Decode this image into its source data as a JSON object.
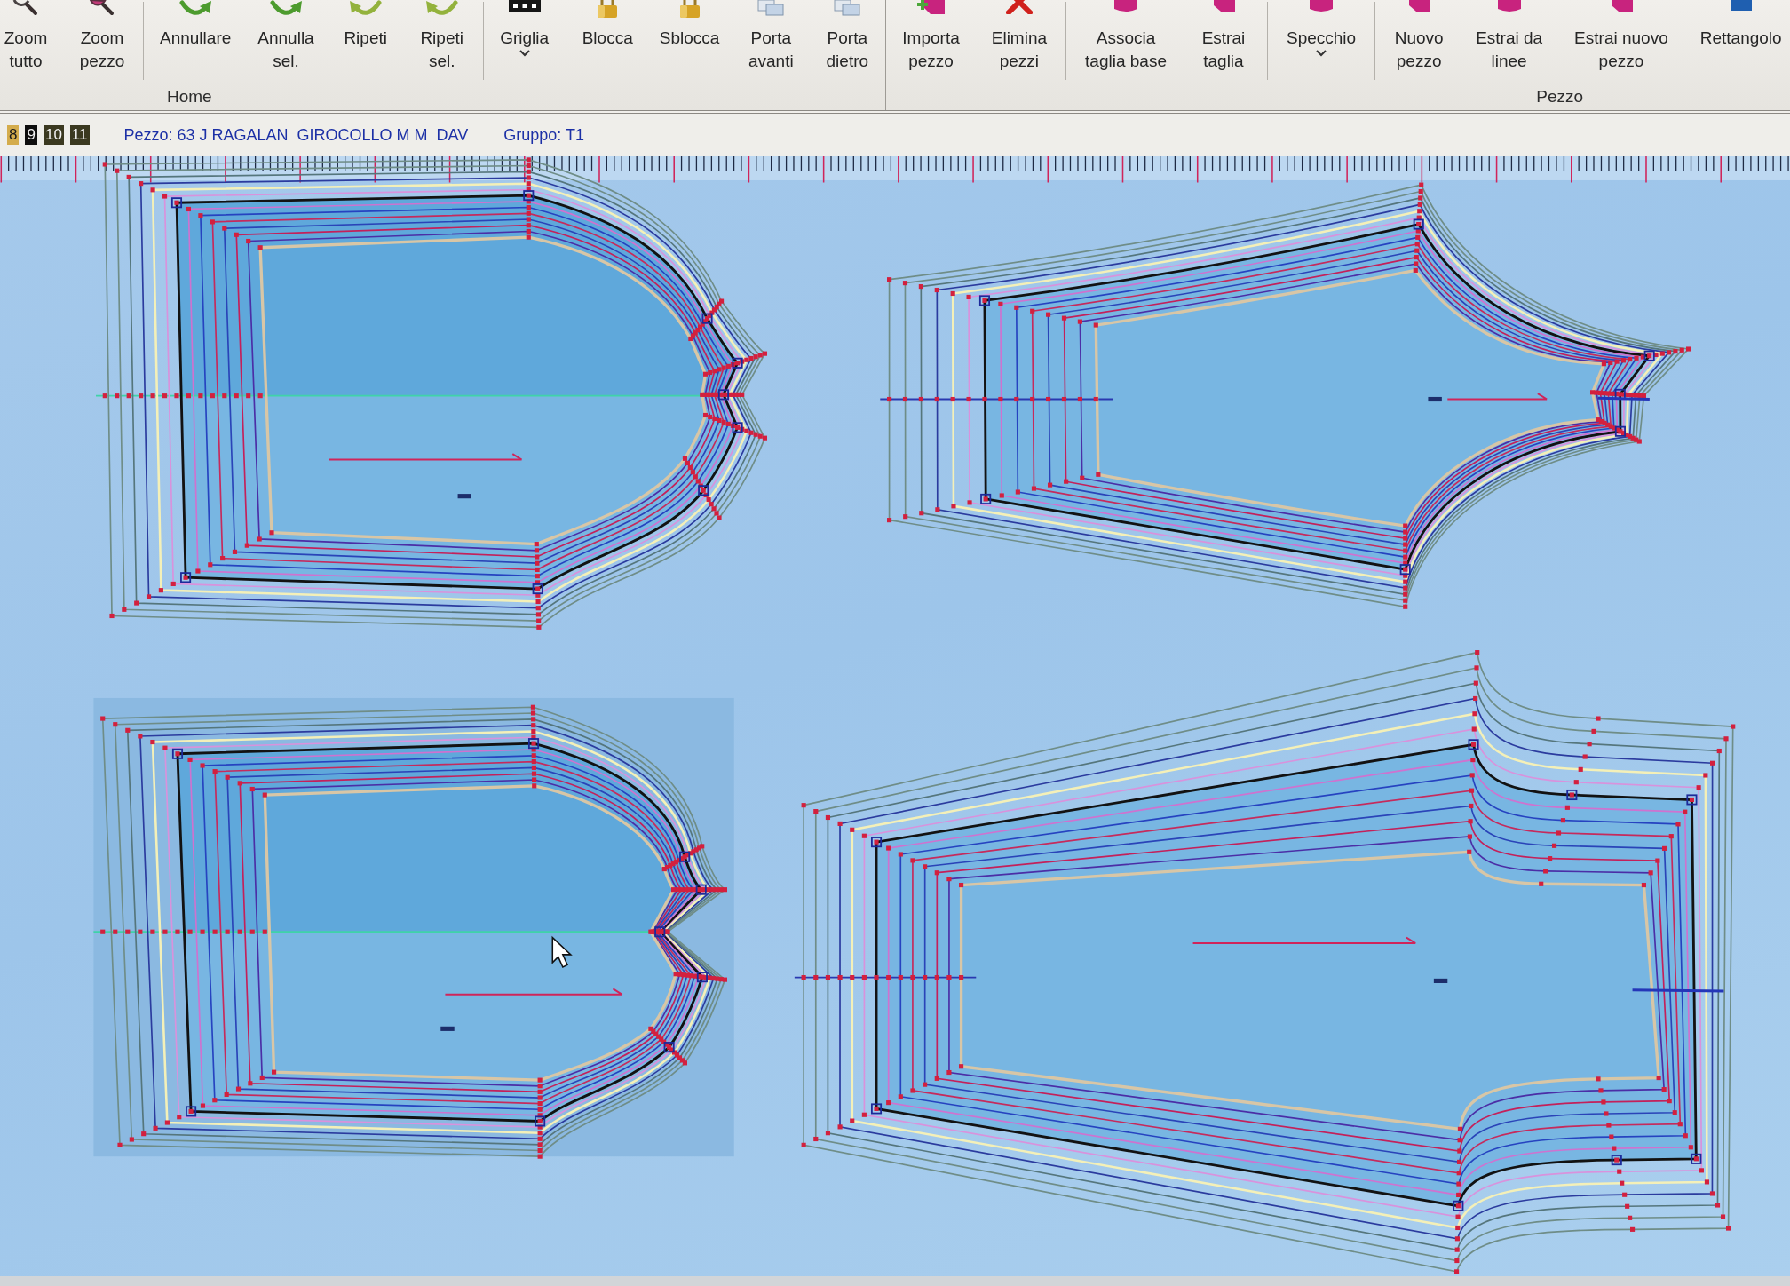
{
  "ribbon": {
    "groups": [
      {
        "label": "Home",
        "sections": [
          [
            {
              "lines": [
                "Zoom",
                "tutto"
              ],
              "dropdown": false
            },
            {
              "lines": [
                "Zoom",
                "pezzo"
              ],
              "dropdown": false
            }
          ],
          [
            {
              "lines": [
                "Annullare"
              ],
              "dropdown": false
            },
            {
              "lines": [
                "Annulla",
                "sel."
              ],
              "dropdown": false
            },
            {
              "lines": [
                "Ripeti"
              ],
              "dropdown": false
            },
            {
              "lines": [
                "Ripeti",
                "sel."
              ],
              "dropdown": false
            }
          ],
          [
            {
              "lines": [
                "Griglia"
              ],
              "dropdown": true
            }
          ],
          [
            {
              "lines": [
                "Blocca"
              ],
              "dropdown": false
            },
            {
              "lines": [
                "Sblocca"
              ],
              "dropdown": false
            },
            {
              "lines": [
                "Porta",
                "avanti"
              ],
              "dropdown": false
            },
            {
              "lines": [
                "Porta",
                "dietro"
              ],
              "dropdown": false
            }
          ]
        ]
      },
      {
        "label": "Pezzo",
        "sections": [
          [
            {
              "lines": [
                "Importa",
                "pezzo"
              ],
              "dropdown": false
            },
            {
              "lines": [
                "Elimina",
                "pezzi"
              ],
              "dropdown": false
            }
          ],
          [
            {
              "lines": [
                "Associa",
                "taglia base"
              ],
              "dropdown": false
            },
            {
              "lines": [
                "Estrai",
                "taglia"
              ],
              "dropdown": false
            }
          ],
          [
            {
              "lines": [
                "Specchio"
              ],
              "dropdown": true
            }
          ],
          [
            {
              "lines": [
                "Nuovo",
                "pezzo"
              ],
              "dropdown": false
            },
            {
              "lines": [
                "Estrai da",
                "linee"
              ],
              "dropdown": false
            },
            {
              "lines": [
                "Estrai nuovo",
                "pezzo"
              ],
              "dropdown": false
            },
            {
              "lines": [
                "Rettangolo"
              ],
              "dropdown": false
            }
          ]
        ]
      }
    ]
  },
  "status": {
    "sizes": [
      {
        "label": "8",
        "color": "#d4ac4c"
      },
      {
        "label": "9",
        "color": "#0e0e0e"
      },
      {
        "label": "10",
        "color": "#3b3920"
      },
      {
        "label": "11",
        "color": "#3b3920"
      }
    ],
    "piece": "Pezzo: 63 J RAGALAN  GIROCOLLO M M  DAV",
    "group": "Gruppo: T1"
  },
  "canvas": {
    "pieces": [
      {
        "kind": "rounded",
        "selected": false
      },
      {
        "kind": "pointed",
        "selected": false
      },
      {
        "kind": "notched",
        "selected": true
      },
      {
        "kind": "flared",
        "selected": false
      }
    ]
  }
}
